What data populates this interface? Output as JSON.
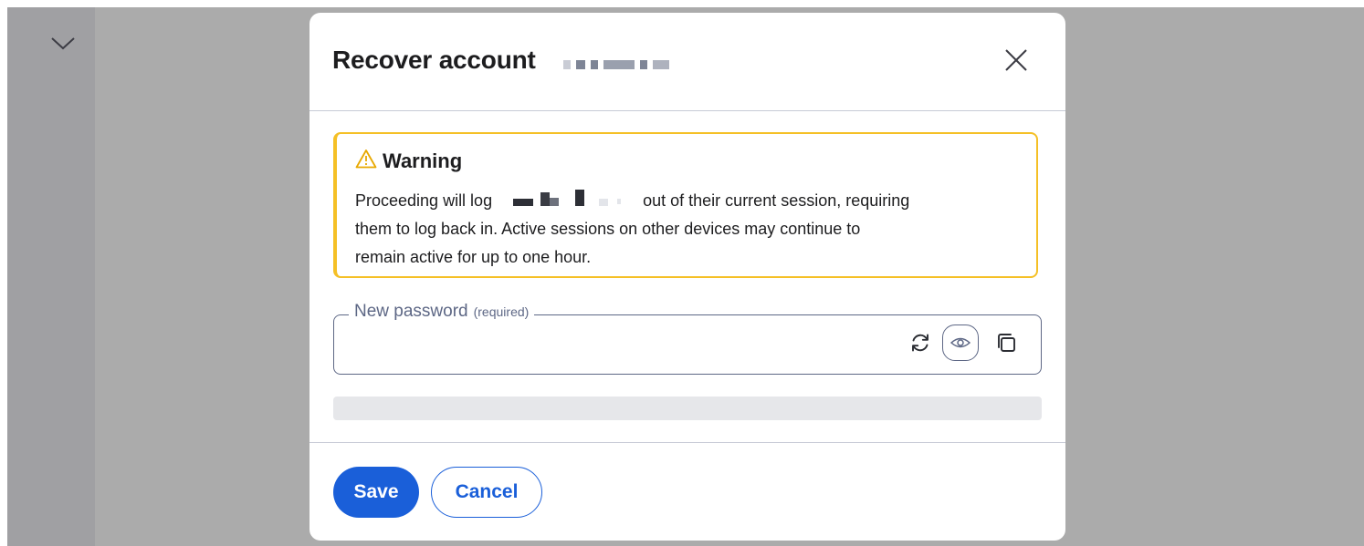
{
  "modal": {
    "title": "Recover account",
    "warning": {
      "title": "Warning",
      "text_before": "Proceeding will log",
      "text_after": "out of their current session, requiring",
      "line2": "them to log back in. Active sessions on other devices may continue to",
      "line3": "remain active for up to one hour."
    },
    "password": {
      "label": "New password",
      "required_hint": "(required)",
      "value": "",
      "strength": 0
    },
    "buttons": {
      "save": "Save",
      "cancel": "Cancel"
    }
  },
  "icons": {
    "rail": "chevron-down-icon",
    "close": "close-icon",
    "warning": "warning-triangle-icon",
    "regenerate": "refresh-icon",
    "toggle_visibility": "eye-icon",
    "copy": "copy-icon"
  },
  "colors": {
    "accent": "#1a5fd9",
    "warning_border": "#f5c026",
    "field_border": "#5d6785",
    "backdrop": "#ababab"
  }
}
